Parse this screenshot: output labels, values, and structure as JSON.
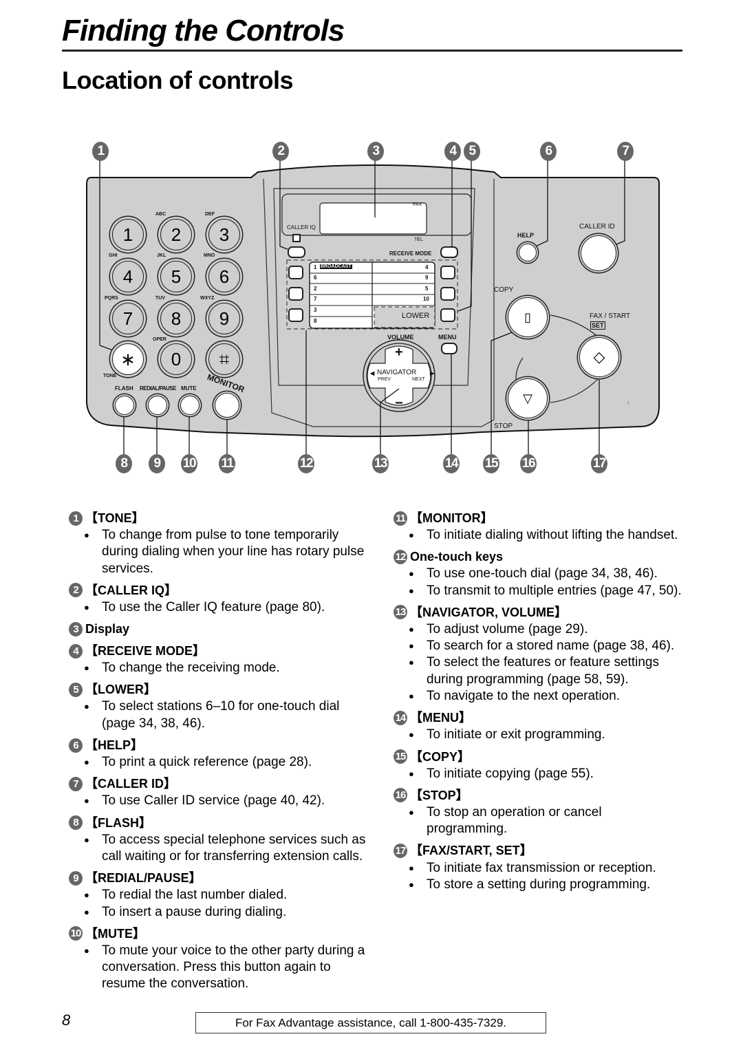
{
  "header": {
    "title": "Finding the Controls",
    "section": "Location of controls"
  },
  "diagram": {
    "callouts_top": [
      "1",
      "2",
      "3",
      "4",
      "5",
      "6",
      "7"
    ],
    "callouts_bottom": [
      "8",
      "9",
      "10",
      "11",
      "12",
      "13",
      "14",
      "15",
      "16",
      "17"
    ],
    "keypad": {
      "keys": [
        {
          "digit": "1",
          "letters": ""
        },
        {
          "digit": "2",
          "letters": "ABC"
        },
        {
          "digit": "3",
          "letters": "DEF"
        },
        {
          "digit": "4",
          "letters": "GHI"
        },
        {
          "digit": "5",
          "letters": "JKL"
        },
        {
          "digit": "6",
          "letters": "MNO"
        },
        {
          "digit": "7",
          "letters": "PQRS"
        },
        {
          "digit": "8",
          "letters": "TUV"
        },
        {
          "digit": "9",
          "letters": "WXYZ"
        },
        {
          "digit": "∗",
          "letters": ""
        },
        {
          "digit": "0",
          "letters": "OPER"
        },
        {
          "digit": "⌗",
          "letters": ""
        }
      ],
      "tone_label": "TONE"
    },
    "function_buttons": {
      "flash": "FLASH",
      "redial": "REDIAL/PAUSE",
      "mute": "MUTE",
      "monitor": "MONITOR"
    },
    "display": {
      "caller_iq": "CALLER IQ",
      "fax": "FAX",
      "tel": "TEL",
      "receive_mode": "RECEIVE MODE"
    },
    "one_touch": {
      "rows": [
        {
          "left": "1",
          "left_tag": "BROADCAST",
          "right": "4"
        },
        {
          "left": "6",
          "left_tag": "",
          "right": "9"
        },
        {
          "left": "2",
          "left_tag": "",
          "right": "5"
        },
        {
          "left": "7",
          "left_tag": "",
          "right": "10"
        },
        {
          "left": "3",
          "left_tag": "",
          "right": ""
        },
        {
          "left": "8",
          "left_tag": "",
          "right": ""
        }
      ],
      "lower": "LOWER"
    },
    "navigator": {
      "volume": "VOLUME",
      "menu": "MENU",
      "navigator": "NAVIGATOR",
      "prev": "PREV",
      "next": "NEXT",
      "plus": "+",
      "minus": "−"
    },
    "right_panel": {
      "help": "HELP",
      "caller_id": "CALLER ID",
      "copy": "COPY",
      "fax_start": "FAX / START",
      "set": "SET",
      "stop": "STOP"
    }
  },
  "descriptions": {
    "left": [
      {
        "num": "1",
        "title": "【TONE】",
        "bullets": [
          "To change from pulse to tone temporarily during dialing when your line has rotary pulse services."
        ]
      },
      {
        "num": "2",
        "title": "【CALLER IQ】",
        "bullets": [
          "To use the Caller IQ feature (page 80)."
        ]
      },
      {
        "num": "3",
        "title": "Display",
        "bullets": []
      },
      {
        "num": "4",
        "title": "【RECEIVE MODE】",
        "bullets": [
          "To change the receiving mode."
        ]
      },
      {
        "num": "5",
        "title": "【LOWER】",
        "bullets": [
          "To select stations 6–10 for one-touch dial (page 34, 38, 46)."
        ]
      },
      {
        "num": "6",
        "title": "【HELP】",
        "bullets": [
          "To print a quick reference (page 28)."
        ]
      },
      {
        "num": "7",
        "title": "【CALLER ID】",
        "bullets": [
          "To use Caller ID service (page 40, 42)."
        ]
      },
      {
        "num": "8",
        "title": "【FLASH】",
        "bullets": [
          "To access special telephone services such as call waiting or for transferring extension calls."
        ]
      },
      {
        "num": "9",
        "title": "【REDIAL/PAUSE】",
        "bullets": [
          "To redial the last number dialed.",
          "To insert a pause during dialing."
        ]
      },
      {
        "num": "10",
        "title": "【MUTE】",
        "bullets": [
          "To mute your voice to the other party during a conversation. Press this button again to resume the conversation."
        ]
      }
    ],
    "right": [
      {
        "num": "11",
        "title": "【MONITOR】",
        "bullets": [
          "To initiate dialing without lifting the handset."
        ]
      },
      {
        "num": "12",
        "title": "One-touch keys",
        "bullets": [
          "To use one-touch dial (page 34, 38, 46).",
          "To transmit to multiple entries (page 47, 50)."
        ]
      },
      {
        "num": "13",
        "title": "【NAVIGATOR, VOLUME】",
        "bullets": [
          "To adjust volume (page 29).",
          "To search for a stored name (page 38, 46).",
          "To select the features or feature settings during programming (page 58, 59).",
          "To navigate to the next operation."
        ]
      },
      {
        "num": "14",
        "title": "【MENU】",
        "bullets": [
          "To initiate or exit programming."
        ]
      },
      {
        "num": "15",
        "title": "【COPY】",
        "bullets": [
          "To initiate copying (page 55)."
        ]
      },
      {
        "num": "16",
        "title": "【STOP】",
        "bullets": [
          "To stop an operation or cancel programming."
        ]
      },
      {
        "num": "17",
        "title": "【FAX/START, SET】",
        "bullets": [
          "To initiate fax transmission or reception.",
          "To store a setting during programming."
        ]
      }
    ]
  },
  "footer": {
    "page_number": "8",
    "assistance": "For Fax Advantage assistance, call 1-800-435-7329."
  }
}
